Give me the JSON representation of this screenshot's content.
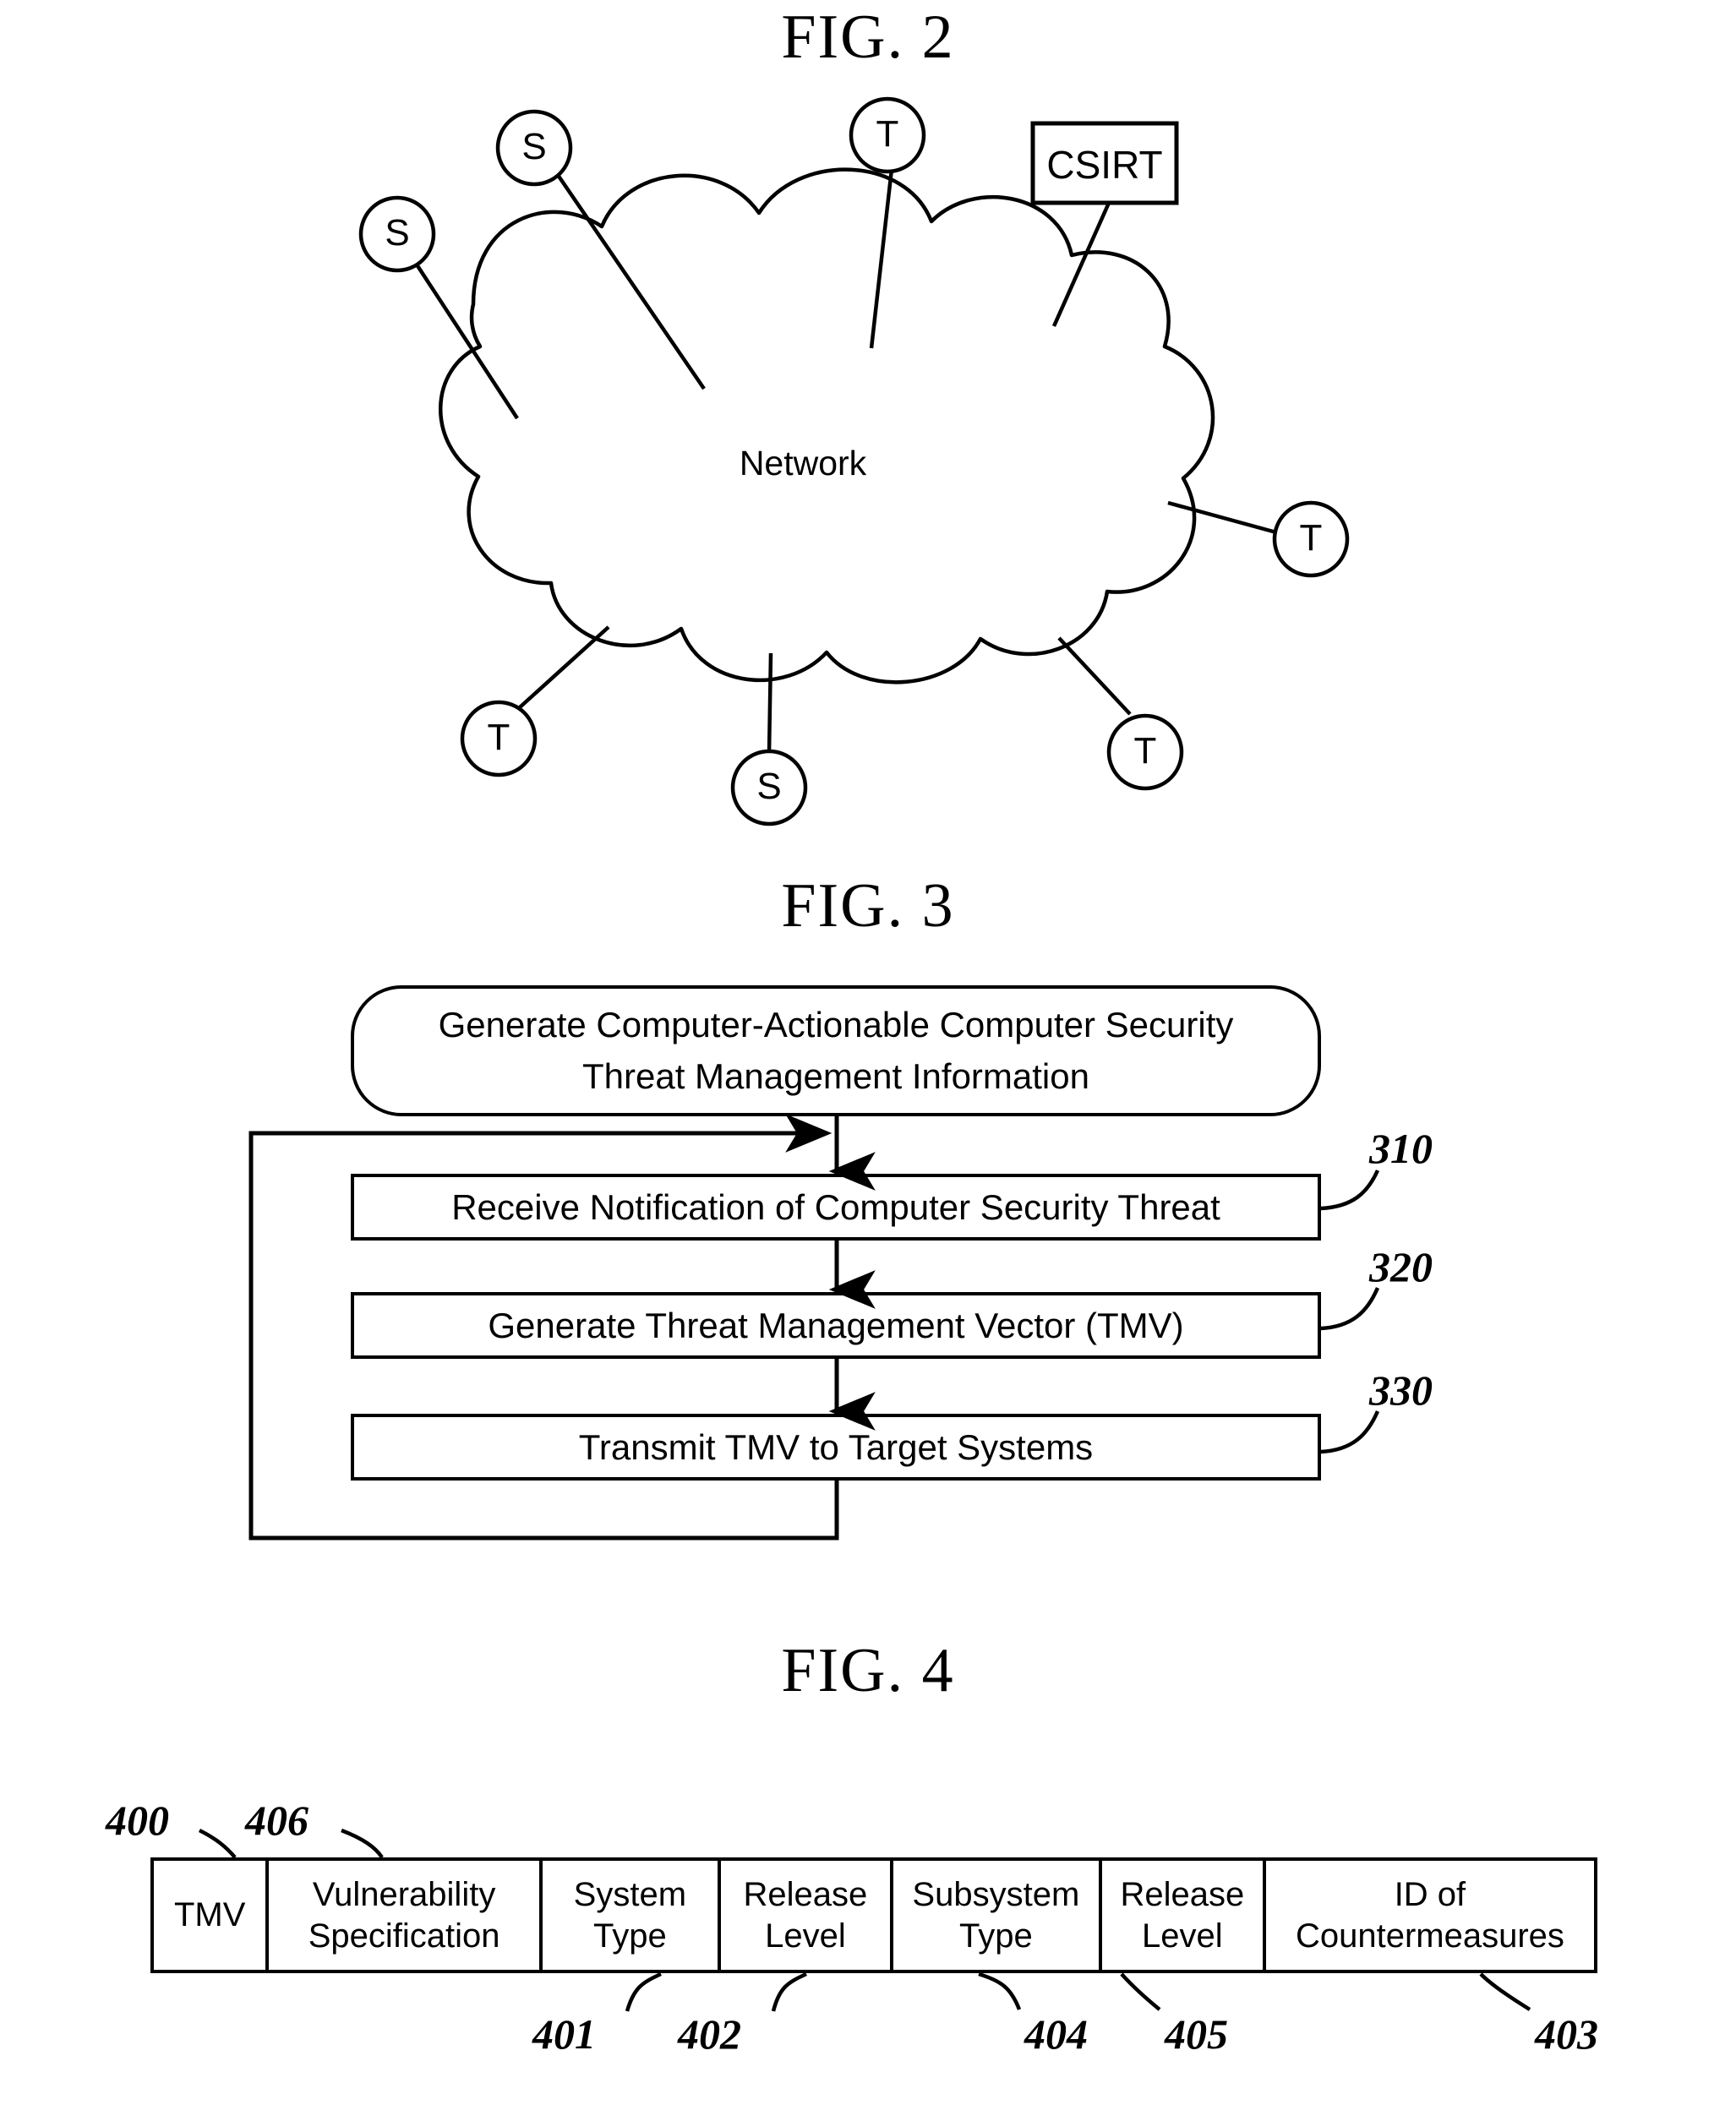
{
  "figures": {
    "fig2": {
      "title": "FIG. 2",
      "cloud_label": "Network",
      "csirt_label": "CSIRT",
      "nodes": [
        {
          "id": "s-top-left",
          "label": "S"
        },
        {
          "id": "s-top-mid",
          "label": "S"
        },
        {
          "id": "t-top",
          "label": "T"
        },
        {
          "id": "t-right",
          "label": "T"
        },
        {
          "id": "t-bottom-left",
          "label": "T"
        },
        {
          "id": "s-bottom",
          "label": "S"
        },
        {
          "id": "t-bottom-right",
          "label": "T"
        }
      ]
    },
    "fig3": {
      "title": "FIG. 3",
      "terminator": "Generate Computer-Actionable Computer Security Threat Management Information",
      "terminator_line1": "Generate Computer-Actionable Computer Security",
      "terminator_line2": "Threat Management Information",
      "steps": [
        {
          "label": "Receive Notification of Computer Security Threat",
          "ref": "310"
        },
        {
          "label": "Generate Threat Management Vector (TMV)",
          "ref": "320"
        },
        {
          "label": "Transmit TMV to Target Systems",
          "ref": "330"
        }
      ]
    },
    "fig4": {
      "title": "FIG. 4",
      "fields": [
        {
          "line1": "TMV",
          "line2": "",
          "ref": "400"
        },
        {
          "line1": "Vulnerability",
          "line2": "Specification",
          "ref": "406"
        },
        {
          "line1": "System",
          "line2": "Type",
          "ref": "401"
        },
        {
          "line1": "Release",
          "line2": "Level",
          "ref": "402"
        },
        {
          "line1": "Subsystem",
          "line2": "Type",
          "ref": "404"
        },
        {
          "line1": "Release",
          "line2": "Level",
          "ref": "405"
        },
        {
          "line1": "ID of",
          "line2": "Countermeasures",
          "ref": "403"
        }
      ],
      "refs": {
        "r400": "400",
        "r406": "406",
        "r401": "401",
        "r402": "402",
        "r404": "404",
        "r405": "405",
        "r403": "403"
      }
    }
  },
  "colors": {
    "ink": "#000000",
    "paper": "#ffffff"
  }
}
